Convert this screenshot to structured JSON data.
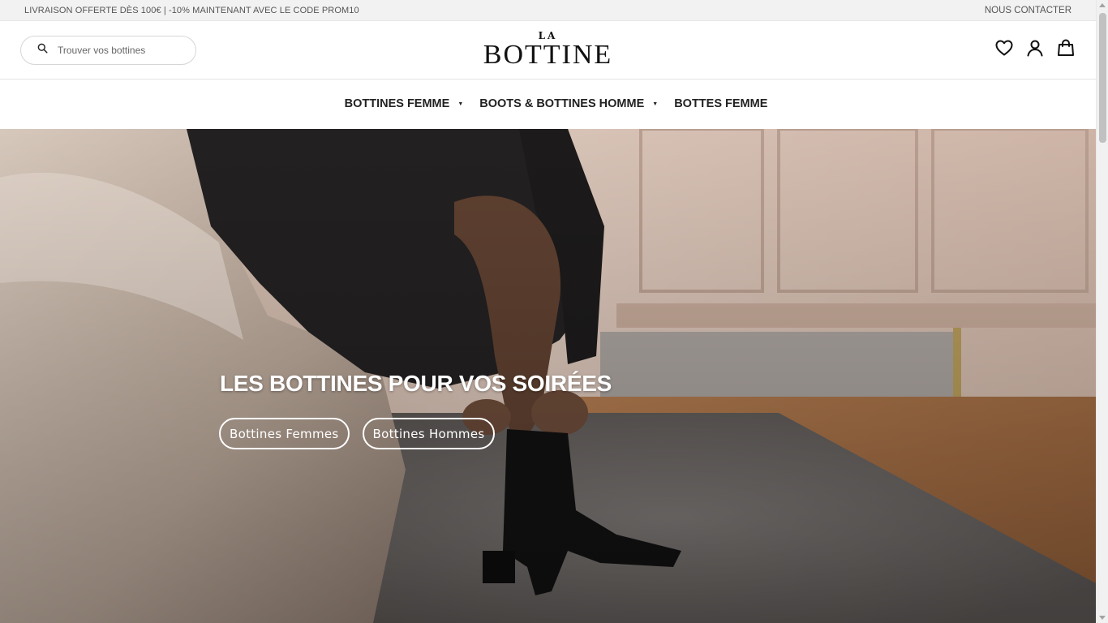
{
  "announcement": {
    "promo_text": "LIVRAISON OFFERTE DÈS 100€ | -10% MAINTENANT AVEC LE CODE PROM10",
    "contact_link": "NOUS CONTACTER"
  },
  "header": {
    "search_placeholder": "Trouver vos bottines",
    "logo_top": "LA",
    "logo_name": "BOTTINE",
    "icons": [
      "heart-icon",
      "user-icon",
      "shopping-bag-icon"
    ]
  },
  "nav": {
    "items": [
      {
        "label": "BOTTINES FEMME",
        "has_dropdown": true
      },
      {
        "label": "BOOTS & BOTTINES HOMME",
        "has_dropdown": true
      },
      {
        "label": "BOTTES FEMME",
        "has_dropdown": false
      }
    ]
  },
  "hero": {
    "title": "LES BOTTINES POUR VOS SOIRÉES",
    "buttons": [
      {
        "label": "Bottines Femmes"
      },
      {
        "label": "Bottines Hommes"
      }
    ]
  },
  "colors": {
    "topbar_bg": "#f2f2f2",
    "text_dark": "#1a1a1a",
    "hero_text": "#ffffff"
  }
}
